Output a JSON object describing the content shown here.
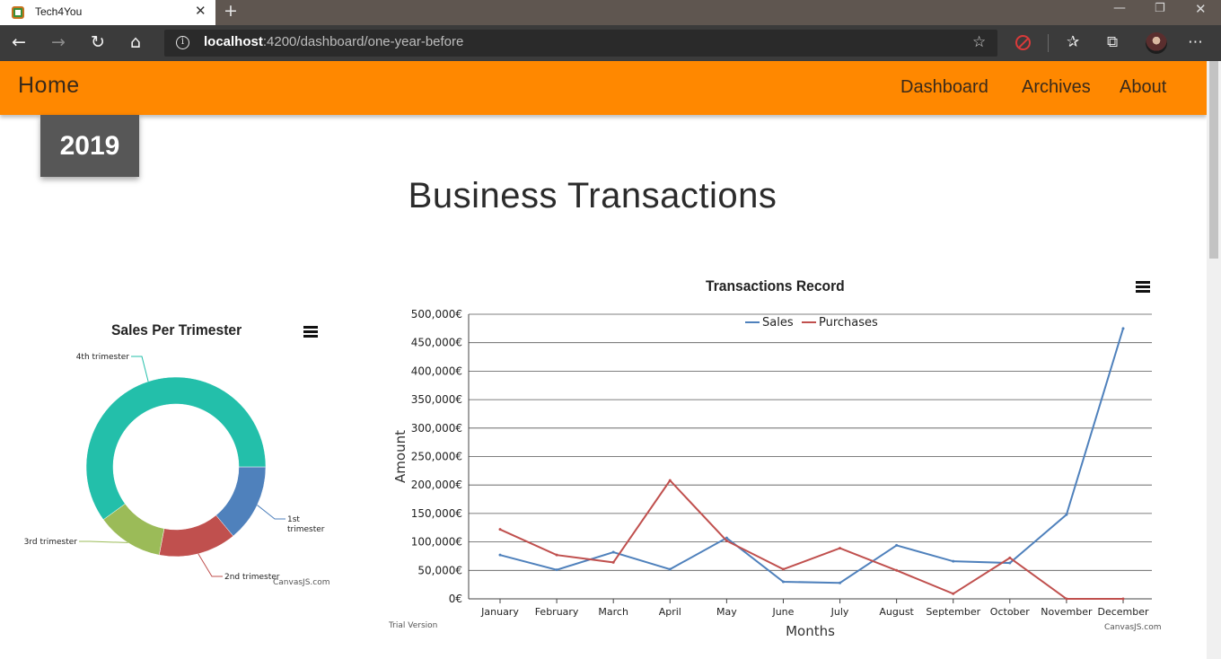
{
  "browser": {
    "tab_title": "Tech4You",
    "url_host": "localhost",
    "url_rest": ":4200/dashboard/one-year-before"
  },
  "navbar": {
    "brand": "Home",
    "links": [
      "Dashboard",
      "Archives",
      "About"
    ]
  },
  "year_badge": "2019",
  "page_title": "Business Transactions",
  "chart_data": [
    {
      "type": "pie",
      "title": "Sales Per Trimester",
      "labels": [
        "1st trimester",
        "2nd trimester",
        "3rd trimester",
        "4th trimester"
      ],
      "values": [
        14,
        14,
        12,
        60
      ],
      "colors": [
        "#4f81bc",
        "#c0504e",
        "#9bbb58",
        "#23bfaa"
      ],
      "credit": "CanvasJS.com"
    },
    {
      "type": "line",
      "title": "Transactions Record",
      "categories": [
        "January",
        "February",
        "March",
        "April",
        "May",
        "June",
        "July",
        "August",
        "September",
        "October",
        "November",
        "December"
      ],
      "series": [
        {
          "name": "Sales",
          "color": "#4f81bc",
          "values": [
            77000,
            51000,
            82000,
            52000,
            107000,
            30000,
            28000,
            94000,
            66000,
            63000,
            148000,
            475000
          ]
        },
        {
          "name": "Purchases",
          "color": "#c0504e",
          "values": [
            122000,
            77000,
            64000,
            208000,
            102000,
            52000,
            89000,
            50000,
            9000,
            72000,
            0,
            0
          ]
        }
      ],
      "xlabel": "Months",
      "ylabel": "Amount",
      "ylim": [
        0,
        500000
      ],
      "yticks": [
        "0€",
        "50,000€",
        "100,000€",
        "150,000€",
        "200,000€",
        "250,000€",
        "300,000€",
        "350,000€",
        "400,000€",
        "450,000€",
        "500,000€"
      ],
      "trial": "Trial Version",
      "credit": "CanvasJS.com"
    }
  ]
}
